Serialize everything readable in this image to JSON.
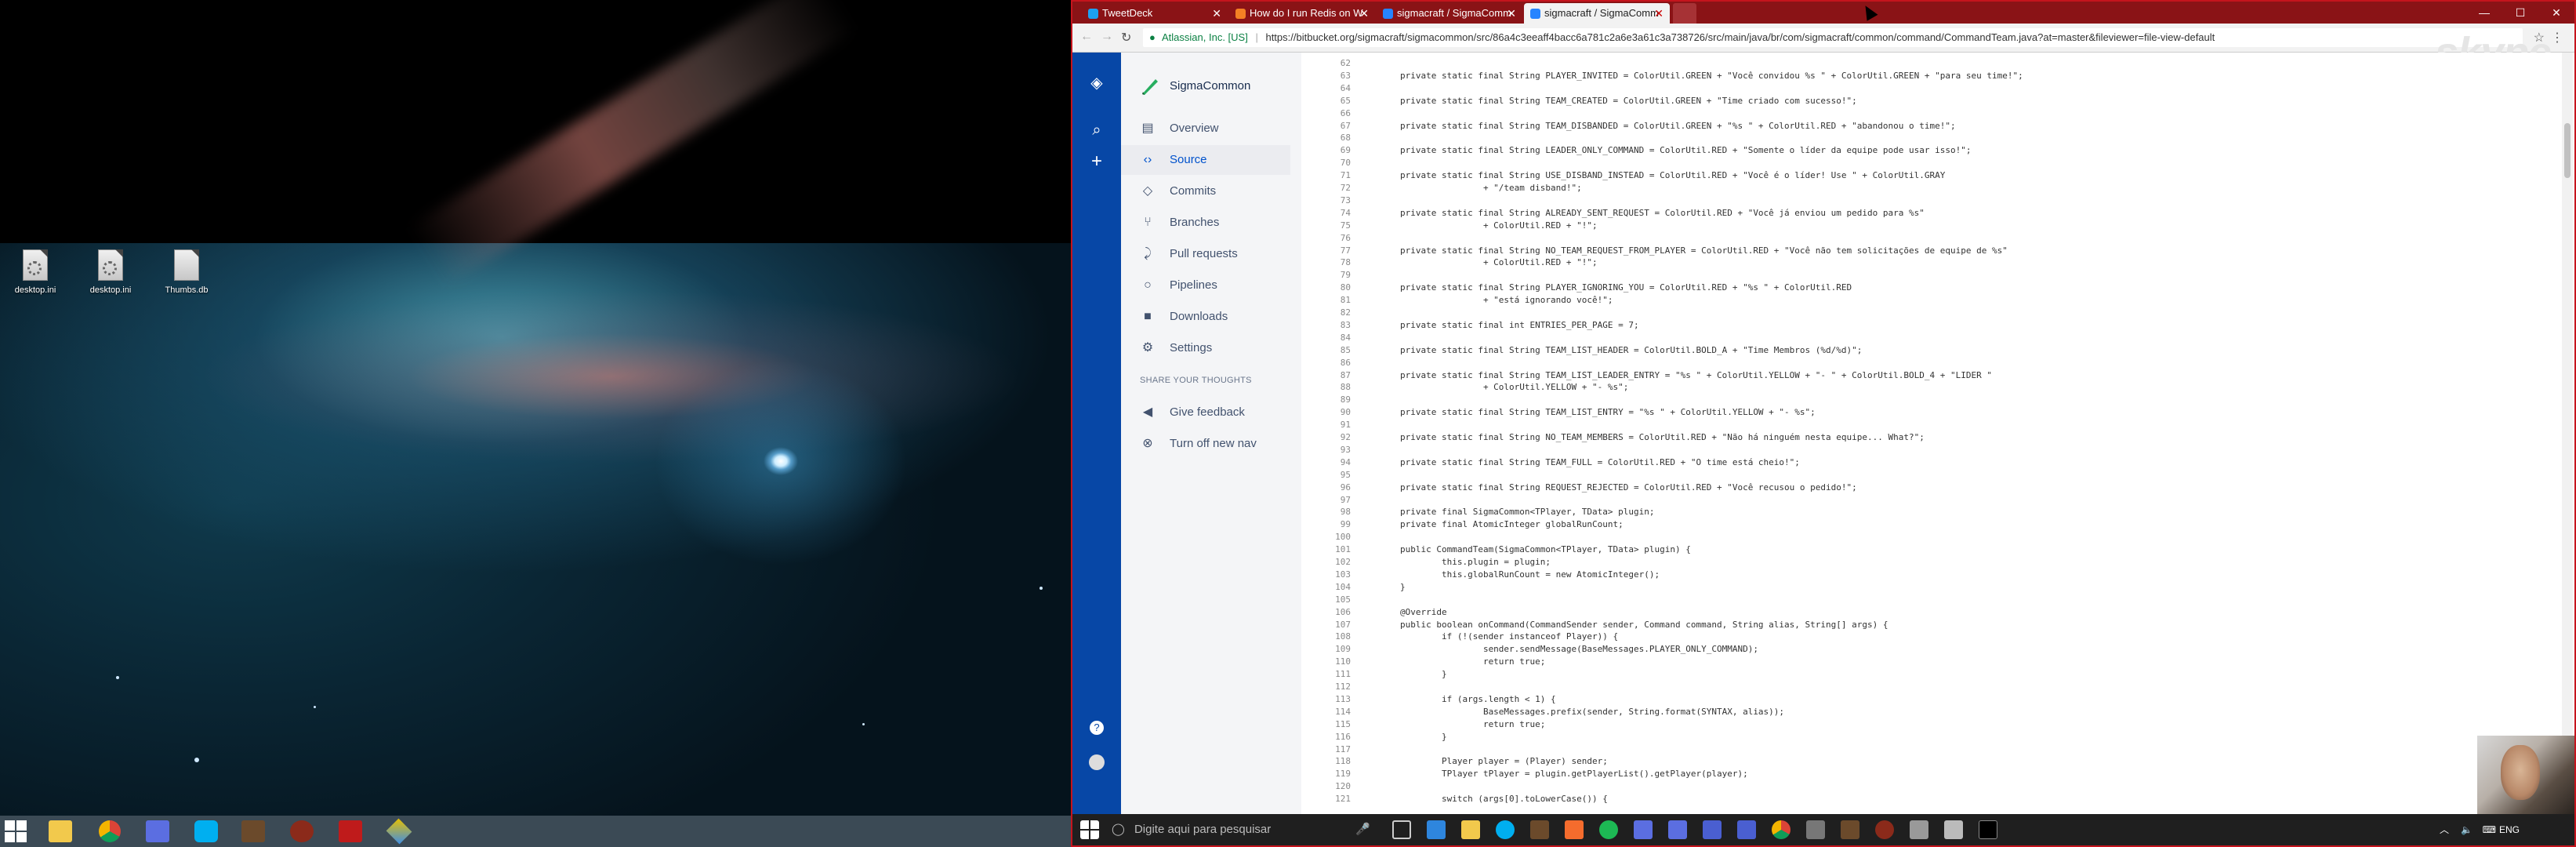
{
  "desktop": {
    "icons": [
      {
        "label": "desktop.ini"
      },
      {
        "label": "desktop.ini"
      },
      {
        "label": "Thumbs.db"
      }
    ]
  },
  "browser": {
    "tabs": [
      {
        "title": "TweetDeck",
        "favicon_color": "#1da1f2"
      },
      {
        "title": "How do I run Redis on W",
        "favicon_color": "#f48024"
      },
      {
        "title": "sigmacraft / SigmaComm",
        "favicon_color": "#2684ff"
      },
      {
        "title": "sigmacraft / SigmaComm",
        "favicon_color": "#2684ff"
      }
    ],
    "secure_label": "Atlassian, Inc. [US]",
    "url": "https://bitbucket.org/sigmacraft/sigmacommon/src/86a4c3eeaff4bacc6a781c2a6e3a61c3a738726/src/main/java/br/com/sigmacraft/common/command/CommandTeam.java?at=master&fileviewer=file-view-default",
    "window_controls": [
      "—",
      "☐",
      "✕"
    ],
    "skype_watermark": "skype"
  },
  "bitbucket": {
    "project_name": "SigmaCommon",
    "nav": [
      {
        "label": "Overview",
        "icon": "overview-icon",
        "glyph": "▤"
      },
      {
        "label": "Source",
        "icon": "source-icon",
        "glyph": "‹›"
      },
      {
        "label": "Commits",
        "icon": "commits-icon",
        "glyph": "◇"
      },
      {
        "label": "Branches",
        "icon": "branches-icon",
        "glyph": "⑂"
      },
      {
        "label": "Pull requests",
        "icon": "pull-requests-icon",
        "glyph": "⤸"
      },
      {
        "label": "Pipelines",
        "icon": "pipelines-icon",
        "glyph": "○"
      },
      {
        "label": "Downloads",
        "icon": "downloads-icon",
        "glyph": "■"
      },
      {
        "label": "Settings",
        "icon": "settings-icon",
        "glyph": "⚙"
      }
    ],
    "share_heading": "SHARE YOUR THOUGHTS",
    "feedback": [
      {
        "label": "Give feedback",
        "icon": "megaphone-icon",
        "glyph": "◀"
      },
      {
        "label": "Turn off new nav",
        "icon": "cancel-icon",
        "glyph": "⊗"
      }
    ]
  },
  "code": {
    "lines": [
      {
        "n": "62",
        "t": ""
      },
      {
        "n": "63",
        "t": "        private static final String PLAYER_INVITED = ColorUtil.GREEN + \"Você convidou %s \" + ColorUtil.GREEN + \"para seu time!\";"
      },
      {
        "n": "64",
        "t": ""
      },
      {
        "n": "65",
        "t": "        private static final String TEAM_CREATED = ColorUtil.GREEN + \"Time criado com sucesso!\";"
      },
      {
        "n": "66",
        "t": ""
      },
      {
        "n": "67",
        "t": "        private static final String TEAM_DISBANDED = ColorUtil.GREEN + \"%s \" + ColorUtil.RED + \"abandonou o time!\";"
      },
      {
        "n": "68",
        "t": ""
      },
      {
        "n": "69",
        "t": "        private static final String LEADER_ONLY_COMMAND = ColorUtil.RED + \"Somente o líder da equipe pode usar isso!\";"
      },
      {
        "n": "70",
        "t": ""
      },
      {
        "n": "71",
        "t": "        private static final String USE_DISBAND_INSTEAD = ColorUtil.RED + \"Você é o líder! Use \" + ColorUtil.GRAY"
      },
      {
        "n": "72",
        "t": "                        + \"/team disband!\";"
      },
      {
        "n": "73",
        "t": ""
      },
      {
        "n": "74",
        "t": "        private static final String ALREADY_SENT_REQUEST = ColorUtil.RED + \"Você já enviou um pedido para %s\""
      },
      {
        "n": "75",
        "t": "                        + ColorUtil.RED + \"!\";"
      },
      {
        "n": "76",
        "t": ""
      },
      {
        "n": "77",
        "t": "        private static final String NO_TEAM_REQUEST_FROM_PLAYER = ColorUtil.RED + \"Você não tem solicitações de equipe de %s\""
      },
      {
        "n": "78",
        "t": "                        + ColorUtil.RED + \"!\";"
      },
      {
        "n": "79",
        "t": ""
      },
      {
        "n": "80",
        "t": "        private static final String PLAYER_IGNORING_YOU = ColorUtil.RED + \"%s \" + ColorUtil.RED"
      },
      {
        "n": "81",
        "t": "                        + \"está ignorando você!\";"
      },
      {
        "n": "82",
        "t": ""
      },
      {
        "n": "83",
        "t": "        private static final int ENTRIES_PER_PAGE = 7;"
      },
      {
        "n": "84",
        "t": ""
      },
      {
        "n": "85",
        "t": "        private static final String TEAM_LIST_HEADER = ColorUtil.BOLD_A + \"Time Membros (%d/%d)\";"
      },
      {
        "n": "86",
        "t": ""
      },
      {
        "n": "87",
        "t": "        private static final String TEAM_LIST_LEADER_ENTRY = \"%s \" + ColorUtil.YELLOW + \"- \" + ColorUtil.BOLD_4 + \"LIDER \""
      },
      {
        "n": "88",
        "t": "                        + ColorUtil.YELLOW + \"- %s\";"
      },
      {
        "n": "89",
        "t": ""
      },
      {
        "n": "90",
        "t": "        private static final String TEAM_LIST_ENTRY = \"%s \" + ColorUtil.YELLOW + \"- %s\";"
      },
      {
        "n": "91",
        "t": ""
      },
      {
        "n": "92",
        "t": "        private static final String NO_TEAM_MEMBERS = ColorUtil.RED + \"Não há ninguém nesta equipe... What?\";"
      },
      {
        "n": "93",
        "t": ""
      },
      {
        "n": "94",
        "t": "        private static final String TEAM_FULL = ColorUtil.RED + \"O time está cheio!\";"
      },
      {
        "n": "95",
        "t": ""
      },
      {
        "n": "96",
        "t": "        private static final String REQUEST_REJECTED = ColorUtil.RED + \"Você recusou o pedido!\";"
      },
      {
        "n": "97",
        "t": ""
      },
      {
        "n": "98",
        "t": "        private final SigmaCommon<TPlayer, TData> plugin;"
      },
      {
        "n": "99",
        "t": "        private final AtomicInteger globalRunCount;"
      },
      {
        "n": "100",
        "t": ""
      },
      {
        "n": "101",
        "t": "        public CommandTeam(SigmaCommon<TPlayer, TData> plugin) {"
      },
      {
        "n": "102",
        "t": "                this.plugin = plugin;"
      },
      {
        "n": "103",
        "t": "                this.globalRunCount = new AtomicInteger();"
      },
      {
        "n": "104",
        "t": "        }"
      },
      {
        "n": "105",
        "t": ""
      },
      {
        "n": "106",
        "t": "        @Override"
      },
      {
        "n": "107",
        "t": "        public boolean onCommand(CommandSender sender, Command command, String alias, String[] args) {"
      },
      {
        "n": "108",
        "t": "                if (!(sender instanceof Player)) {"
      },
      {
        "n": "109",
        "t": "                        sender.sendMessage(BaseMessages.PLAYER_ONLY_COMMAND);"
      },
      {
        "n": "110",
        "t": "                        return true;"
      },
      {
        "n": "111",
        "t": "                }"
      },
      {
        "n": "112",
        "t": ""
      },
      {
        "n": "113",
        "t": "                if (args.length < 1) {"
      },
      {
        "n": "114",
        "t": "                        BaseMessages.prefix(sender, String.format(SYNTAX, alias));"
      },
      {
        "n": "115",
        "t": "                        return true;"
      },
      {
        "n": "116",
        "t": "                }"
      },
      {
        "n": "117",
        "t": ""
      },
      {
        "n": "118",
        "t": "                Player player = (Player) sender;"
      },
      {
        "n": "119",
        "t": "                TPlayer tPlayer = plugin.getPlayerList().getPlayer(player);"
      },
      {
        "n": "120",
        "t": ""
      },
      {
        "n": "121",
        "t": "                switch (args[0].toLowerCase()) {"
      }
    ]
  },
  "taskbar": {
    "search_placeholder": "Digite aqui para pesquisar",
    "language": "ENG"
  }
}
